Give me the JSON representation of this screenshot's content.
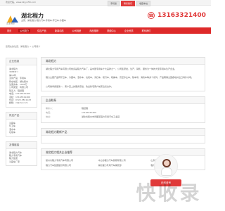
{
  "topbar": {
    "welcome": "欢迎光临，www.kkyy158.com",
    "buttons": [
      "手机版",
      "联系我们",
      "收藏本站"
    ]
  },
  "header": {
    "company_name": "湖北程力",
    "logo_text": "企业站点",
    "company_desc": "主营：湖北程力,程力汽车,专用车,环卫车,冷藏车",
    "phone": "13163321400"
  },
  "nav": {
    "items": [
      "首页",
      "公司简介",
      "供应产品",
      "新闻动态",
      "公司相册",
      "商品推荐",
      "视频中心",
      "企业资质",
      "联系我们"
    ],
    "active_index": 1
  },
  "breadcrumb": "您现在的位置：湖北程力 > 公司简介",
  "sidebar": {
    "company_info_title": "企业信息",
    "company_info_name": "湖北程力",
    "company_rating": "★★★★☆",
    "company_level": "第14年",
    "company_rows": [
      "主营产品：专用车",
      "所在地区：湖北随州",
      "注册资本：1000万",
      "公司类型：有限公司",
      "联系人：程经理",
      "电话：13163321400",
      "手机：13163321400",
      "传真：0722-3811123",
      "邮箱：cl@clw.com"
    ],
    "products_title": "供应产品",
    "products_items": [
      "冷藏车",
      "环卫车",
      "洒水车",
      "垃圾车"
    ],
    "links_title": "友情链接",
    "links_items": [
      "湖北程力汽车",
      "程力专用汽车",
      "程力集团",
      "冷藏车厂家"
    ]
  },
  "main": {
    "about_title": "湖北程力",
    "about_para_1": "湖北程力专用汽车有限公司前身是程力汽车厂，是中国专用车十大品牌之一，公司集研发、生产、销售、服务为一体的大型专用车生产企业。",
    "about_para_2": "程力主要产品有环卫车、冷藏车、洒水车、垃圾车、清扫车、吸污车、吸粪车、高空作业车、随车吊、消防车等多个系列，产品畅销全国各地并出口海外市场。",
    "about_para_3": "公司秉承质量第一、客户至上的服务宗旨，欢迎新老客户前来洽谈合作。",
    "contact_title": "企业联系",
    "contact": [
      {
        "label": "联系人：",
        "value": "程经理"
      },
      {
        "label": "电话：",
        "value": "13163321400"
      },
      {
        "label": "地址：",
        "value": "湖北省随州市曾都区程力专用汽车工业园"
      }
    ],
    "products_title": "湖北程力最新产品",
    "listing_title": "湖北程力相关企业推荐",
    "listing": [
      [
        "随州市程力专用汽车有限公司",
        "程力汽车集团股份有限公司"
      ],
      [
        "中山市程力汽车贸易有限公司",
        "湖北程力专用汽车销售部"
      ],
      [
        "山东省汽车运输公司",
        "程力环卫车销售中心"
      ]
    ]
  },
  "watermark": "快收录",
  "chat_label": "在线咨询"
}
